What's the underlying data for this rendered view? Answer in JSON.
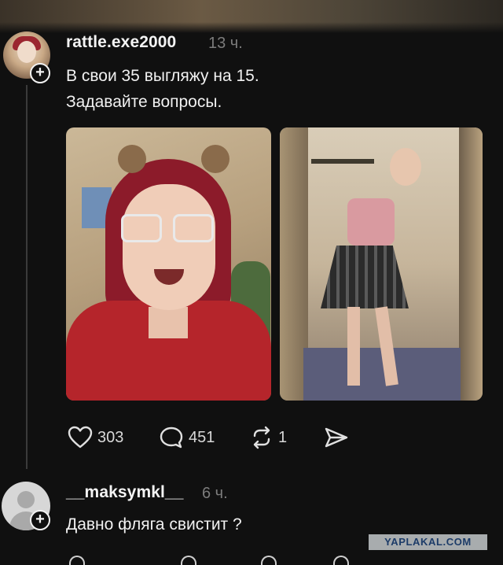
{
  "post": {
    "username": "rattle.exe2000",
    "time": "13 ч.",
    "text_line1": "В свои 35 выгляжу на 15.",
    "text_line2": "Задавайте вопросы.",
    "likes": "303",
    "comments": "451",
    "reposts": "1"
  },
  "reply": {
    "username": "__maksymkl__",
    "time": "6 ч.",
    "text": "Давно фляга свистит ?"
  },
  "watermark": "YAPLAKAL.COM",
  "colors": {
    "background": "#101010",
    "text": "#f1f1f1",
    "muted": "#7c7c7c",
    "watermark_bg": "#a8acae",
    "watermark_text": "#1c3b68"
  }
}
